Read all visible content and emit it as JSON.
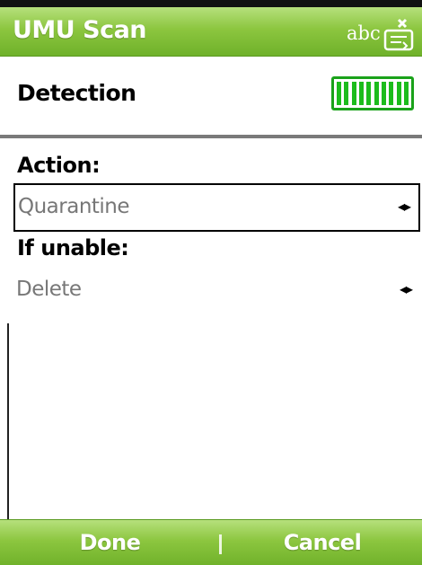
{
  "window": {
    "title": "UMU Scan",
    "input_mode": "abc",
    "input_icon": "keyboard-icon"
  },
  "header": {
    "label": "Detection",
    "battery_icon": "battery-icon",
    "battery_level": 1.0,
    "accent_color": "#1cbc1c"
  },
  "fields": {
    "action": {
      "label": "Action:",
      "value": "Quarantine",
      "arrows": "◂▸"
    },
    "if_unable": {
      "label": "If unable:",
      "value": "Delete",
      "arrows": "◂▸"
    }
  },
  "softkeys": {
    "left": "Done",
    "right": "Cancel"
  },
  "colors": {
    "bar_green": "#8cc63f",
    "divider": "#7a7a7a"
  }
}
